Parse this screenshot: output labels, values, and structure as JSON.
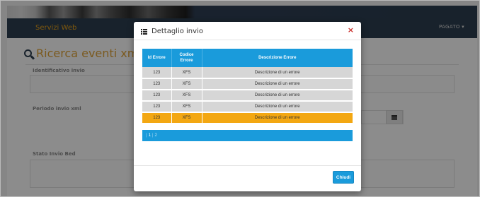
{
  "navbar": {
    "brand": "Servizi Web",
    "user_menu": "PAGATO ▾"
  },
  "page": {
    "title": "Ricerca eventi xml",
    "fields": [
      {
        "label": "Identificativo invio"
      },
      {
        "label": "Periodo invio xml"
      },
      {
        "label": "Stato Invio Bed"
      }
    ]
  },
  "modal": {
    "title": "Dettaglio invio",
    "close_icon": "×",
    "columns": [
      "Id Errore",
      "Codice Errore",
      "Descrizione Errore"
    ],
    "rows": [
      {
        "id": "123",
        "code": "XFS",
        "desc": "Descrizione di un errore"
      },
      {
        "id": "123",
        "code": "XFS",
        "desc": "Descrizione di un errore"
      },
      {
        "id": "123",
        "code": "XFS",
        "desc": "Descrizione di un errore"
      },
      {
        "id": "123",
        "code": "XFS",
        "desc": "Descrizione di un errore"
      },
      {
        "id": "123",
        "code": "XFS",
        "desc": "Descrizione di un errore"
      }
    ],
    "selected_row_index": 4,
    "pagination": {
      "pages": [
        "1",
        "2"
      ],
      "current": "1"
    },
    "close_button": "Chiudi"
  },
  "colors": {
    "navbar": "#2c3e50",
    "table_header": "#1a9bdb",
    "row_default": "#d6d6d6",
    "row_selected": "#f3a712",
    "close_x": "#c9302c",
    "title_accent": "#e0a43a"
  }
}
